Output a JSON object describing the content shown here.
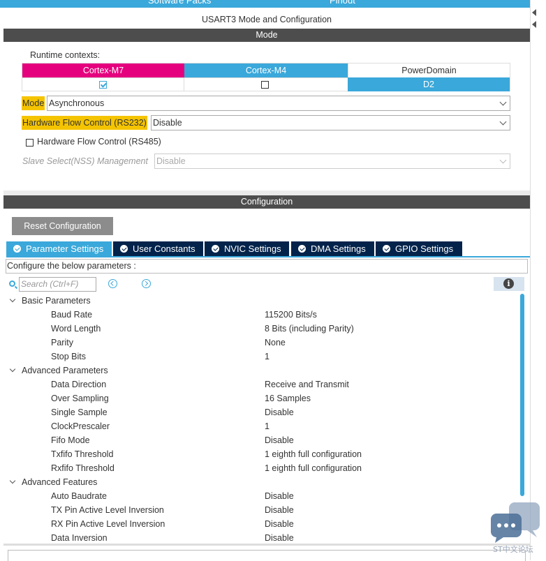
{
  "top_menu": {
    "software_packs": "Software Packs",
    "pinout": "Pinout"
  },
  "window_title": "USART3 Mode and Configuration",
  "mode_section": {
    "header": "Mode",
    "runtime_contexts_label": "Runtime contexts:",
    "contexts": [
      {
        "name": "Cortex-M7",
        "color": "#e5007e",
        "checked": true
      },
      {
        "name": "Cortex-M4",
        "color": "#3aa8da",
        "checked": false
      },
      {
        "name": "PowerDomain",
        "color": "#ffffff",
        "value": "D2"
      }
    ],
    "mode_label": "Mode",
    "mode_value": "Asynchronous",
    "hw_flow_rs232_label": "Hardware Flow Control (RS232)",
    "hw_flow_rs232_value": "Disable",
    "hw_flow_rs485_label": "Hardware Flow Control (RS485)",
    "hw_flow_rs485_checked": false,
    "slave_select_label": "Slave Select(NSS) Management",
    "slave_select_value": "Disable"
  },
  "config_section": {
    "header": "Configuration",
    "reset_button": "Reset Configuration",
    "tabs": [
      {
        "label": "Parameter Settings",
        "active": true
      },
      {
        "label": "User Constants",
        "active": false
      },
      {
        "label": "NVIC Settings",
        "active": false
      },
      {
        "label": "DMA Settings",
        "active": false
      },
      {
        "label": "GPIO Settings",
        "active": false
      }
    ],
    "hint": "Configure the below parameters :",
    "search_placeholder": "Search (Ctrl+F)",
    "groups": [
      {
        "name": "Basic Parameters",
        "params": [
          {
            "name": "Baud Rate",
            "value": "115200 Bits/s"
          },
          {
            "name": "Word Length",
            "value": "8 Bits (including Parity)"
          },
          {
            "name": "Parity",
            "value": "None"
          },
          {
            "name": "Stop Bits",
            "value": "1"
          }
        ]
      },
      {
        "name": "Advanced Parameters",
        "params": [
          {
            "name": "Data Direction",
            "value": "Receive and Transmit"
          },
          {
            "name": "Over Sampling",
            "value": "16 Samples"
          },
          {
            "name": "Single Sample",
            "value": "Disable"
          },
          {
            "name": "ClockPrescaler",
            "value": "1"
          },
          {
            "name": "Fifo Mode",
            "value": "Disable"
          },
          {
            "name": "Txfifo Threshold",
            "value": "1 eighth full configuration"
          },
          {
            "name": "Rxfifo Threshold",
            "value": "1 eighth full configuration"
          }
        ]
      },
      {
        "name": "Advanced Features",
        "params": [
          {
            "name": "Auto Baudrate",
            "value": "Disable"
          },
          {
            "name": "TX Pin Active Level Inversion",
            "value": "Disable"
          },
          {
            "name": "RX Pin Active Level Inversion",
            "value": "Disable"
          },
          {
            "name": "Data Inversion",
            "value": "Disable"
          }
        ]
      }
    ]
  },
  "watermark": "ST中文论坛",
  "colors": {
    "accent": "#3aa8da",
    "magenta": "#e5007e",
    "highlight": "#f5c400",
    "tab_dark": "#03234b"
  }
}
